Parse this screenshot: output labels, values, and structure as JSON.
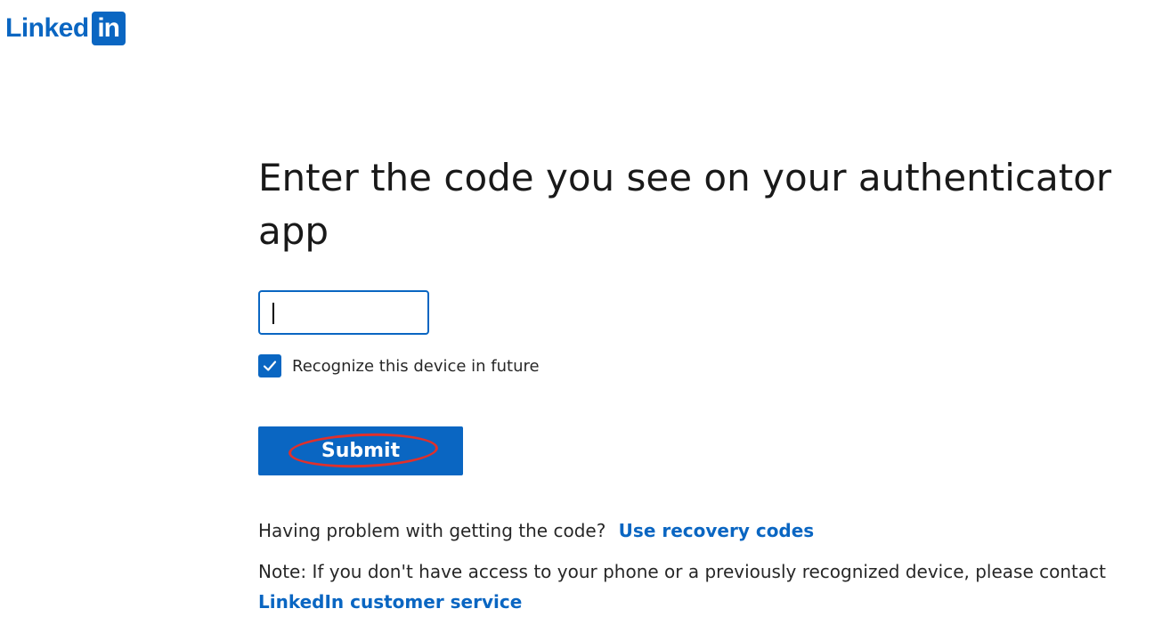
{
  "logo": {
    "word": "Linked",
    "box": "in",
    "brand_color": "#0a66c2"
  },
  "main": {
    "title": "Enter the code you see on your authenticator app",
    "code_input": {
      "value": "",
      "placeholder": ""
    },
    "remember_device": {
      "label": "Recognize this device in future",
      "checked": true
    },
    "submit_label": "Submit",
    "help_text": "Having problem with getting the code?",
    "recovery_link": "Use recovery codes",
    "note_text": "Note: If you don't have access to your phone or a previously recognized device, please contact",
    "customer_service_link": "LinkedIn customer service"
  },
  "colors": {
    "accent": "#0a66c2",
    "annotation": "#e0302b"
  }
}
